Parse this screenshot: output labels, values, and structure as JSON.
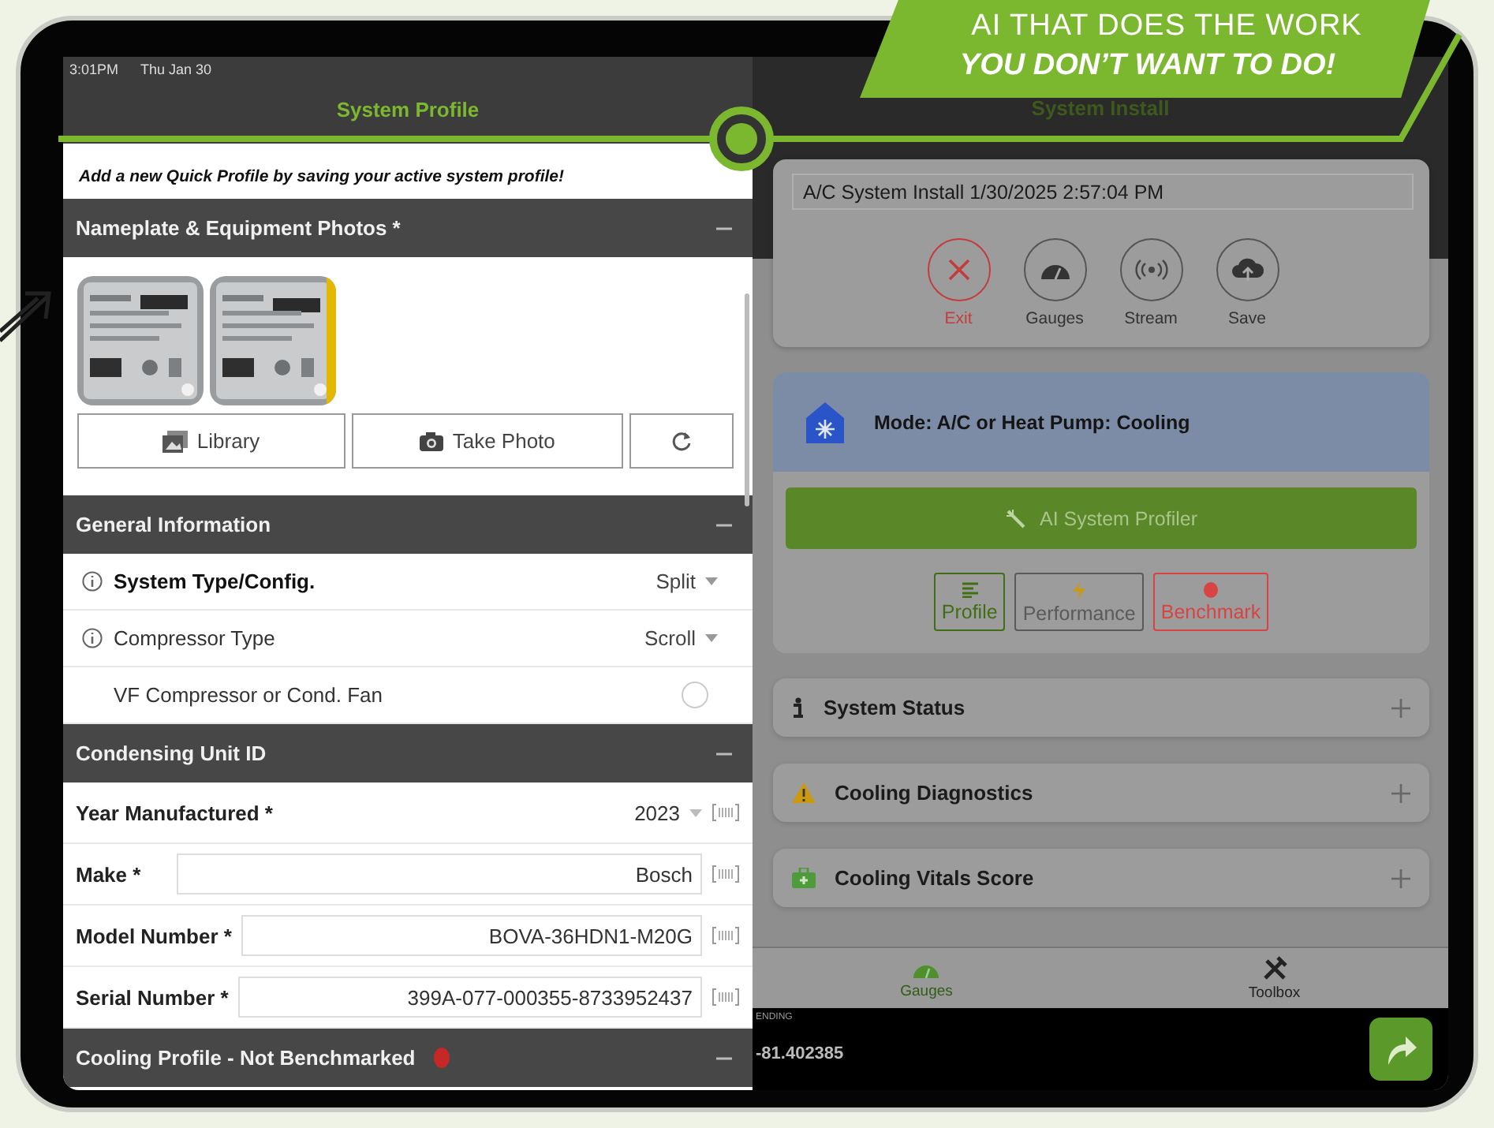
{
  "banner": {
    "line_1": "AI THAT DOES THE WORK",
    "line_2": "YOU DON’T WANT TO DO!"
  },
  "status_bar": {
    "time": "3:01PM",
    "date": "Thu Jan 30"
  },
  "left_panel": {
    "title": "System Profile",
    "notice": "Add a new Quick Profile by saving your active system profile!",
    "photos_section": {
      "title": "Nameplate & Equipment Photos *",
      "expanded": true,
      "buttons": [
        {
          "kind": "library",
          "label": "Library"
        },
        {
          "kind": "camera",
          "label": "Take Photo"
        },
        {
          "kind": "refresh"
        }
      ]
    },
    "general_section": {
      "title": "General Information",
      "expanded": true,
      "rows": [
        {
          "kind": "select",
          "label": "System Type/Config.",
          "value": "Split",
          "info": true,
          "emphasis": true
        },
        {
          "kind": "select",
          "label": "Compressor Type",
          "value": "Scroll",
          "info": true,
          "emphasis": false
        },
        {
          "kind": "toggle",
          "label": "VF Compressor or Cond. Fan",
          "checked": false,
          "info": false,
          "emphasis": false
        }
      ]
    },
    "unit_section": {
      "title": "Condensing Unit ID",
      "expanded": true,
      "rows": [
        {
          "kind": "select",
          "label": "Year Manufactured *",
          "value": "2023"
        },
        {
          "kind": "field",
          "label": "Make *",
          "value": "Bosch"
        },
        {
          "kind": "field",
          "label": "Model Number *",
          "value": "BOVA-36HDN1-M20G"
        },
        {
          "kind": "field",
          "label": "Serial Number *",
          "value": "399A-077-000355-8733952437"
        }
      ]
    },
    "profile_section": {
      "title": "Cooling Profile - Not Benchmarked",
      "expanded": true,
      "status_dot": true
    }
  },
  "right_panel": {
    "title": "System Install",
    "session_name": "A/C System Install 1/30/2025 2:57:04 PM",
    "actions": [
      {
        "kind": "exit",
        "label": "Exit"
      },
      {
        "kind": "gauges",
        "label": "Gauges"
      },
      {
        "kind": "stream",
        "label": "Stream"
      },
      {
        "kind": "save",
        "label": "Save"
      }
    ],
    "mode": "Mode: A/C or Heat Pump: Cooling",
    "profiler_button": "AI System Profiler",
    "tabs": [
      {
        "kind": "profile",
        "label": "Profile",
        "color": "#3f6e14"
      },
      {
        "kind": "performance",
        "label": "Performance",
        "color": "#5a5a5a"
      },
      {
        "kind": "benchmark",
        "label": "Benchmark",
        "color": "#d84343"
      }
    ],
    "sections": [
      {
        "kind": "info",
        "title": "System Status",
        "expanded": false
      },
      {
        "kind": "warning",
        "title": "Cooling Diagnostics",
        "expanded": false
      },
      {
        "kind": "medkit",
        "title": "Cooling Vitals Score",
        "expanded": false
      }
    ],
    "bottom_tabs": [
      {
        "kind": "gauges",
        "label": "Gauges",
        "selected": true
      },
      {
        "kind": "toolbox",
        "label": "Toolbox",
        "selected": false
      }
    ],
    "footer": {
      "status": "ENDING",
      "coordinate": "-81.402385"
    }
  }
}
